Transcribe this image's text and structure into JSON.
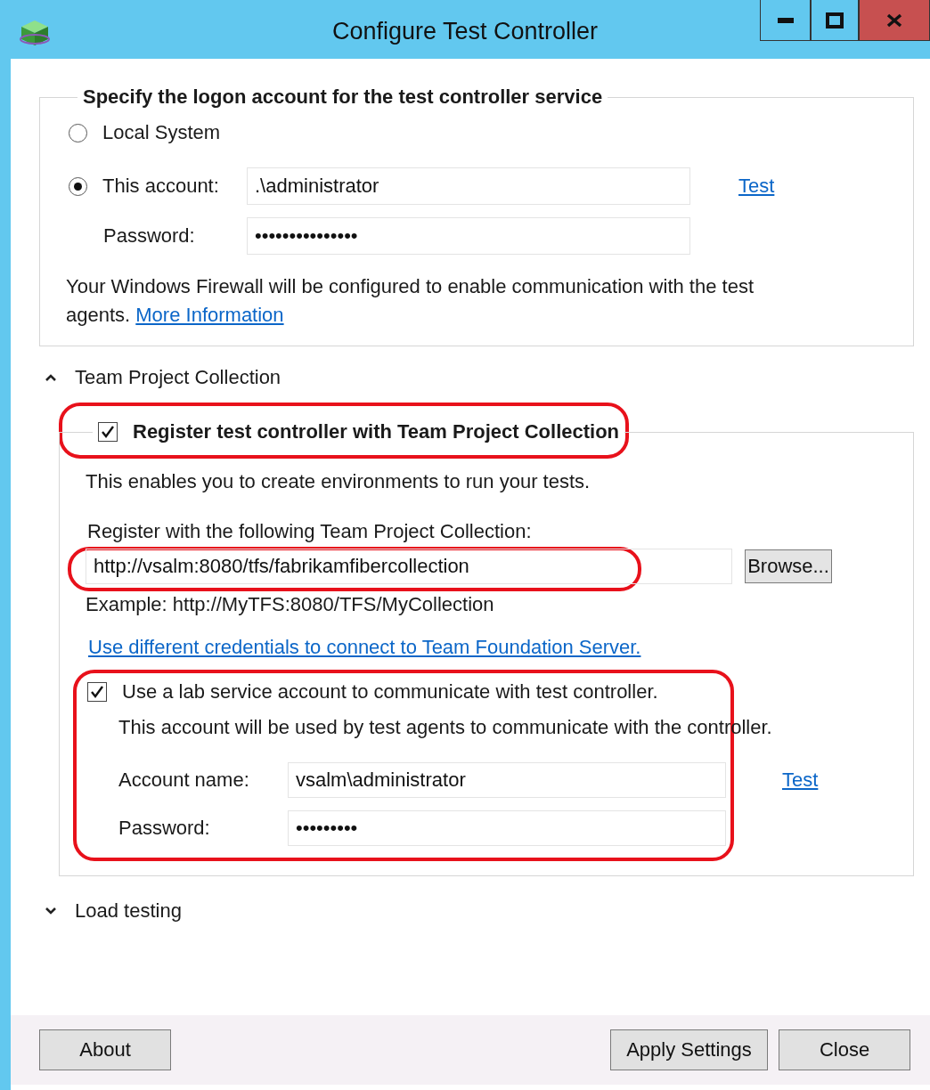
{
  "window": {
    "title": "Configure Test Controller"
  },
  "logon": {
    "legend": "Specify the logon account for the test controller service",
    "options": [
      {
        "label": "Local System",
        "selected": false
      },
      {
        "label": "This account:",
        "selected": true
      }
    ],
    "account": {
      "value": ".\\administrator"
    },
    "test_link": "Test",
    "password": {
      "label": "Password:",
      "value": "•••••••••••••••"
    },
    "note": "Your Windows Firewall will be configured to enable communication with the test agents.",
    "more_link": "More Information"
  },
  "team_project_collection": {
    "label": "Team Project Collection",
    "expanded": true,
    "register": {
      "label": "Register test controller with Team Project Collection",
      "checked": true,
      "description": "This enables you to create environments to run your tests.",
      "collection_label": "Register with the following Team Project Collection:",
      "collection_url": {
        "value": "http://vsalm:8080/tfs/fabrikamfibercollection"
      },
      "browse_button": "Browse...",
      "example": "Example: http://MyTFS:8080/TFS/MyCollection",
      "credentials_link": "Use different credentials to connect to Team Foundation Server.",
      "lab_account": {
        "label": "Use a lab service account to communicate with test controller.",
        "checked": true,
        "description": "This account will be used by test agents to communicate with the controller.",
        "account_name": {
          "label": "Account name:",
          "value": "vsalm\\administrator"
        },
        "test_link": "Test",
        "password": {
          "label": "Password:",
          "value": "•••••••••"
        }
      }
    }
  },
  "load_testing": {
    "label": "Load testing",
    "expanded": false
  },
  "buttons": {
    "about": "About",
    "apply": "Apply Settings",
    "close": "Close"
  }
}
